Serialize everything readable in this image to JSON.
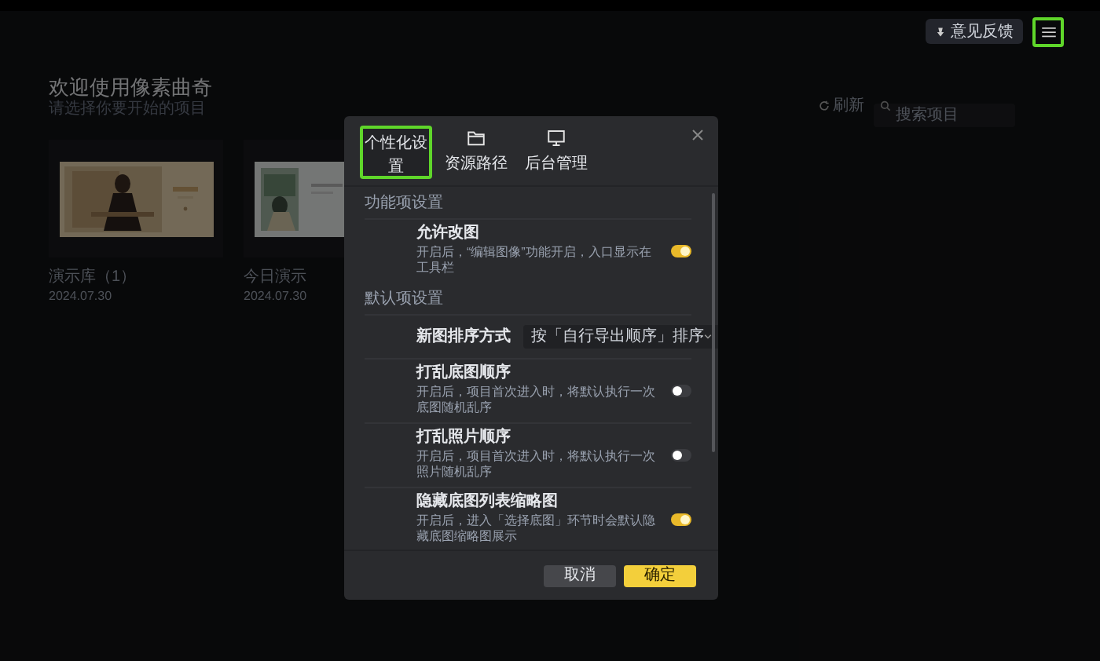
{
  "app_bar": {
    "feedback_button": "意见反馈",
    "menu_highlighted": true
  },
  "welcome": {
    "title": "欢迎使用像素曲奇",
    "subtitle": "请选择你要开始的项目"
  },
  "toolbar": {
    "refresh": "刷新",
    "search": {
      "placeholder": "搜索项目"
    }
  },
  "projects": [
    {
      "name": "演示库（1）",
      "date": "2024.07.30",
      "kind": "picture"
    },
    {
      "name": "今日演示",
      "date": "2024.07.30",
      "kind": "picture"
    }
  ],
  "dialog": {
    "tabs": [
      {
        "label": "个性化设置",
        "selected": true
      },
      {
        "label": "资源路径",
        "selected": false
      },
      {
        "label": "后台管理",
        "selected": false
      }
    ],
    "sections": [
      {
        "title": "功能项设置",
        "items": [
          {
            "kind": "toggle",
            "label": "允许改图",
            "description": "开启后，“编辑图像”功能开启，入口显示在工具栏",
            "on": true
          }
        ]
      },
      {
        "title": "默认项设置",
        "items": [
          {
            "kind": "select",
            "label": "新图排序方式",
            "value": "按「自行导出顺序」排序"
          },
          {
            "kind": "toggle",
            "label": "打乱底图顺序",
            "description": "开启后，项目首次进入时，将默认执行一次底图随机乱序",
            "on": false
          },
          {
            "kind": "toggle",
            "label": "打乱照片顺序",
            "description": "开启后，项目首次进入时，将默认执行一次照片随机乱序",
            "on": false
          },
          {
            "kind": "toggle",
            "label": "隐藏底图列表缩略图",
            "description": "开启后，进入「选择底图」环节时会默认隐藏底图缩略图展示",
            "on": true
          }
        ]
      }
    ],
    "buttons": [
      {
        "label": "取消",
        "kind": "secondary"
      },
      {
        "label": "确定",
        "kind": "primary"
      }
    ]
  }
}
